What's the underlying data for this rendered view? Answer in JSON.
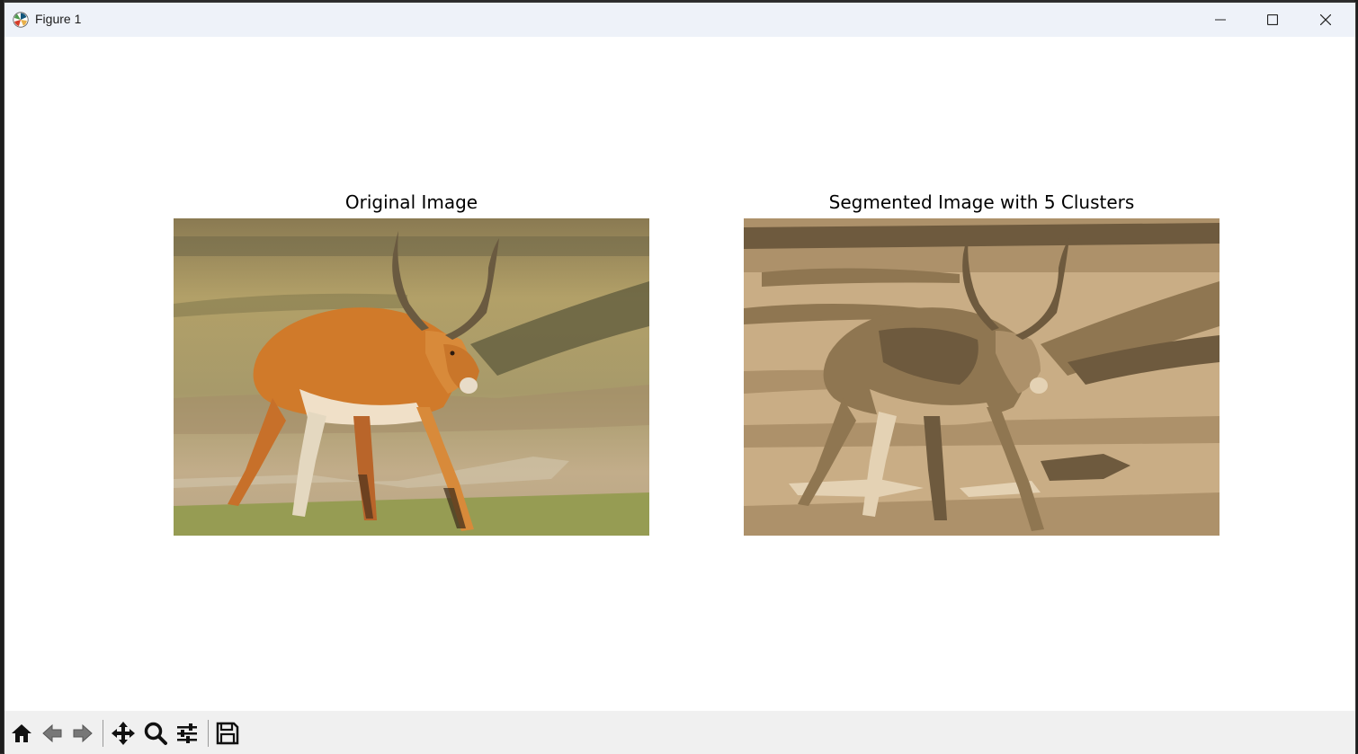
{
  "window": {
    "title": "Figure 1",
    "controls": [
      "minimize",
      "maximize",
      "close"
    ]
  },
  "figure": {
    "left_axes": {
      "title": "Original Image"
    },
    "right_axes": {
      "title": "Segmented Image with 5 Clusters"
    }
  },
  "toolbar": {
    "items": [
      "home-icon",
      "back-arrow-icon",
      "forward-arrow-icon",
      "pan-icon",
      "zoom-icon",
      "configure-subplots-icon",
      "save-icon"
    ]
  },
  "colors": {
    "titlebar": "#eef2f9",
    "toolbar": "#f0f0f0",
    "segment_palette": [
      "#6e5a3e",
      "#8f7651",
      "#ad916a",
      "#c9ad85",
      "#e4d2b4"
    ]
  }
}
